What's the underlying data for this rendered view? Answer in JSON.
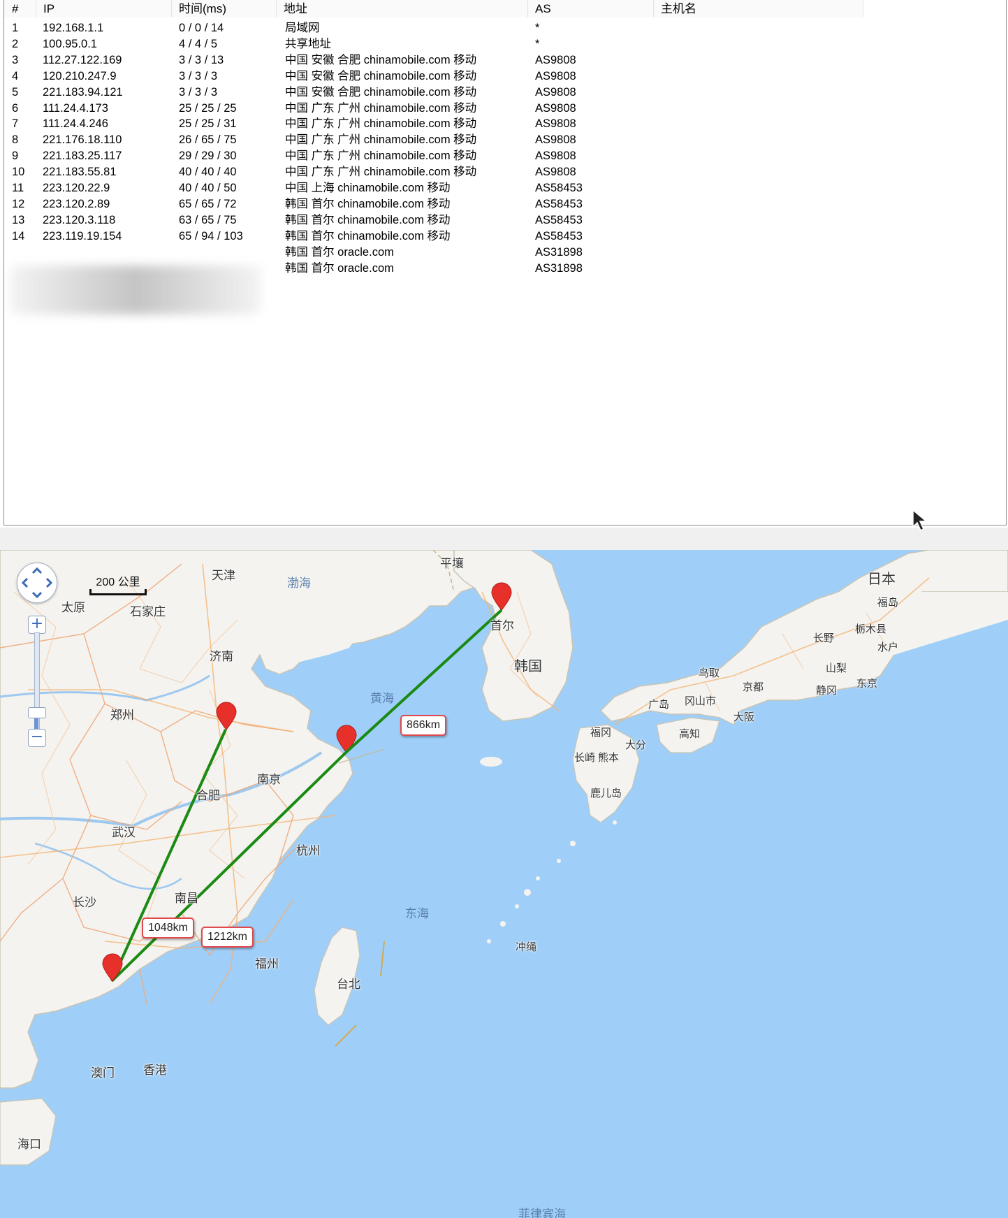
{
  "table": {
    "headers": [
      "#",
      "IP",
      "时间(ms)",
      "地址",
      "AS",
      "主机名"
    ],
    "rows": [
      {
        "n": "1",
        "ip": "192.168.1.1",
        "time": "0 / 0 / 14",
        "addr": "局域网",
        "as": "*"
      },
      {
        "n": "2",
        "ip": "100.95.0.1",
        "time": "4 / 4 / 5",
        "addr": "共享地址",
        "as": "*"
      },
      {
        "n": "3",
        "ip": "112.27.122.169",
        "time": "3 / 3 / 13",
        "addr": "中国 安徽 合肥 chinamobile.com 移动",
        "as": "AS9808"
      },
      {
        "n": "4",
        "ip": "120.210.247.9",
        "time": "3 / 3 / 3",
        "addr": "中国 安徽 合肥 chinamobile.com 移动",
        "as": "AS9808"
      },
      {
        "n": "5",
        "ip": "221.183.94.121",
        "time": "3 / 3 / 3",
        "addr": "中国 安徽 合肥 chinamobile.com 移动",
        "as": "AS9808"
      },
      {
        "n": "6",
        "ip": "111.24.4.173",
        "time": "25 / 25 / 25",
        "addr": "中国 广东 广州 chinamobile.com 移动",
        "as": "AS9808"
      },
      {
        "n": "7",
        "ip": "111.24.4.246",
        "time": "25 / 25 / 31",
        "addr": "中国 广东 广州 chinamobile.com 移动",
        "as": "AS9808"
      },
      {
        "n": "8",
        "ip": "221.176.18.110",
        "time": "26 / 65 / 75",
        "addr": "中国 广东 广州 chinamobile.com 移动",
        "as": "AS9808"
      },
      {
        "n": "9",
        "ip": "221.183.25.117",
        "time": "29 / 29 / 30",
        "addr": "中国 广东 广州 chinamobile.com 移动",
        "as": "AS9808"
      },
      {
        "n": "10",
        "ip": "221.183.55.81",
        "time": "40 / 40 / 40",
        "addr": "中国 广东 广州 chinamobile.com 移动",
        "as": "AS9808"
      },
      {
        "n": "11",
        "ip": "223.120.22.9",
        "time": "40 / 40 / 50",
        "addr": "中国 上海 chinamobile.com 移动",
        "as": "AS58453"
      },
      {
        "n": "12",
        "ip": "223.120.2.89",
        "time": "65 / 65 / 72",
        "addr": "韩国 首尔 chinamobile.com 移动",
        "as": "AS58453"
      },
      {
        "n": "13",
        "ip": "223.120.3.118",
        "time": "63 / 65 / 75",
        "addr": "韩国 首尔 chinamobile.com 移动",
        "as": "AS58453"
      },
      {
        "n": "14",
        "ip": "223.119.19.154",
        "time": "65 / 94 / 103",
        "addr": "韩国 首尔 chinamobile.com 移动",
        "as": "AS58453"
      },
      {
        "n": "",
        "ip": "",
        "time": "",
        "addr": "韩国 首尔 oracle.com",
        "as": "AS31898"
      },
      {
        "n": "",
        "ip": "",
        "time": "",
        "addr": "韩国 首尔 oracle.com",
        "as": "AS31898"
      }
    ]
  },
  "map": {
    "scale": "200 公里",
    "distances": {
      "hefei_guangzhou": "1048km",
      "shanghai_guangzhou": "1212km",
      "shanghai_seoul": "866km"
    },
    "route_color": "#1a8a12",
    "marker_color": "#e8302b",
    "labels": {
      "beijing_area": "天津",
      "taiyuan": "太原",
      "shijiazhuang": "石家庄",
      "jinan": "济南",
      "zhengzhou": "郑州",
      "hefei": "合肥",
      "nanjing": "南京",
      "wuhan": "武汉",
      "hangzhou": "杭州",
      "changsha": "长沙",
      "nanchang": "南昌",
      "fuzhou": "福州",
      "taipei": "台北",
      "macau": "澳门",
      "hongkong": "香港",
      "haikou": "海口",
      "pyongyang": "平壤",
      "seoul": "首尔",
      "korea": "韩国",
      "japan": "日本",
      "fukushima": "福岛",
      "tochigi": "栃木县",
      "nagano": "长野",
      "mito": "水户",
      "yamanashi": "山梨",
      "tokyo": "东京",
      "shizuoka": "静冈",
      "kyoto": "京都",
      "tottori": "鸟取",
      "okayama": "冈山市",
      "hiroshima": "广岛",
      "osaka": "大阪",
      "kochi": "高知",
      "fukuoka": "福冈",
      "oita": "大分",
      "nagasaki": "长崎",
      "kumamoto": "熊本",
      "kagoshima": "鹿儿岛",
      "okinawa": "冲绳",
      "bohai": "渤海",
      "yellow_sea": "黄海",
      "east_sea": "东海",
      "philippine_sea": "菲律宾海"
    }
  }
}
